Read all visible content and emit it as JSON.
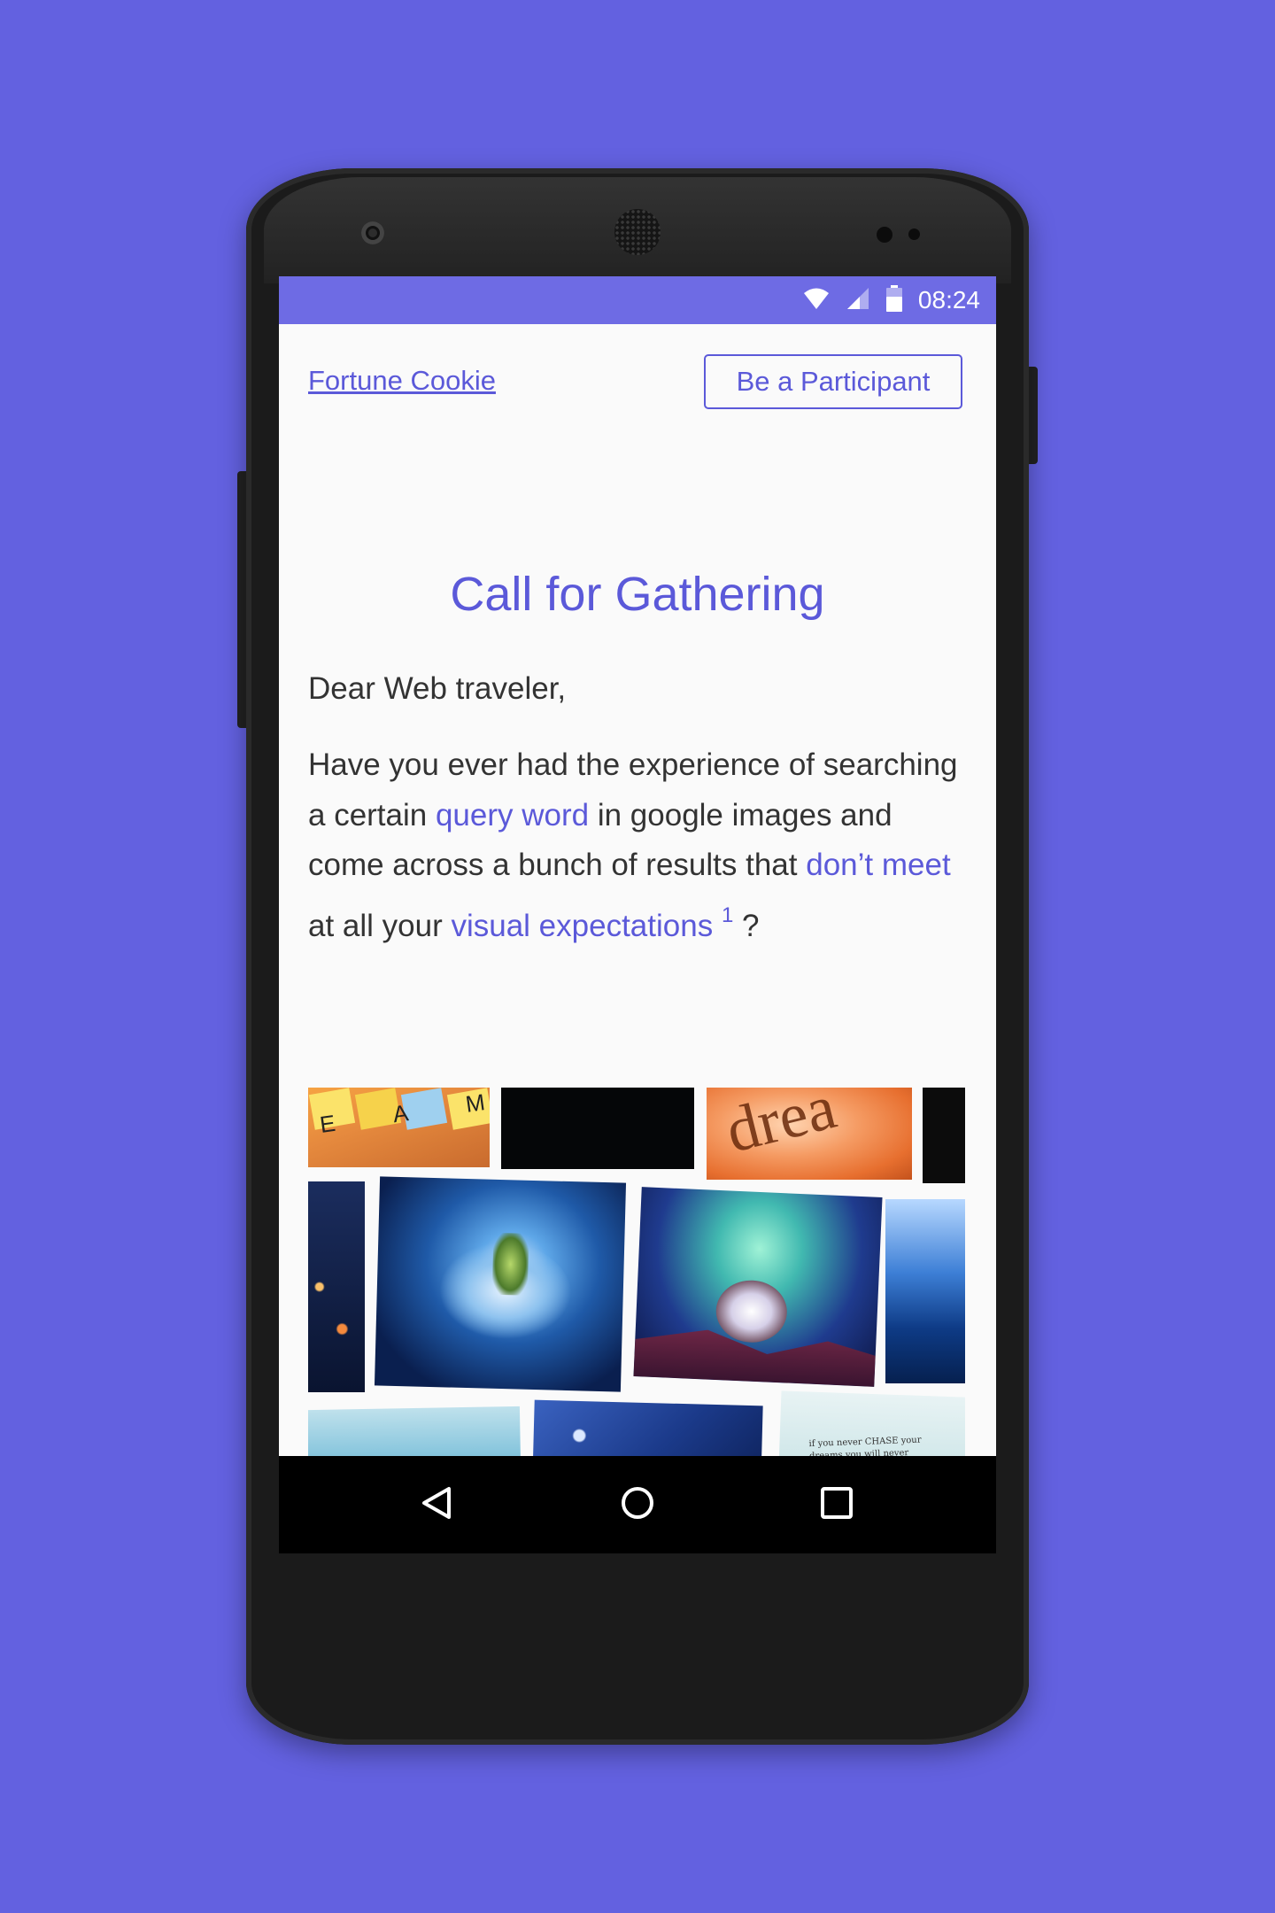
{
  "status_bar": {
    "time": "08:24",
    "icons": [
      "wifi-icon",
      "signal-icon",
      "battery-icon"
    ]
  },
  "header": {
    "brand_link": "Fortune Cookie",
    "cta_button": "Be a Participant"
  },
  "article": {
    "title": "Call for Gathering",
    "greeting": "Dear Web traveler,",
    "paragraph": {
      "part1": "Have you ever had the experience of searching a certain ",
      "link1": "query word",
      "part2": " in google images and come across a bunch of results that ",
      "link2": "don’t meet",
      "part3": " at all your ",
      "link3": "visual expectations",
      "footnote": "1",
      "part4": " ?"
    }
  },
  "collage": {
    "t1_text": "E A M S",
    "t3_text": "drea",
    "t11_text": "if you never CHASE your dreams you will never CATCH them"
  },
  "nav_bar": {
    "icons": [
      "back-icon",
      "home-icon",
      "recents-icon"
    ]
  },
  "colors": {
    "background": "#6361e0",
    "accent": "#5b59d9",
    "status_bar": "#6e6be4",
    "body_text": "#333333"
  }
}
